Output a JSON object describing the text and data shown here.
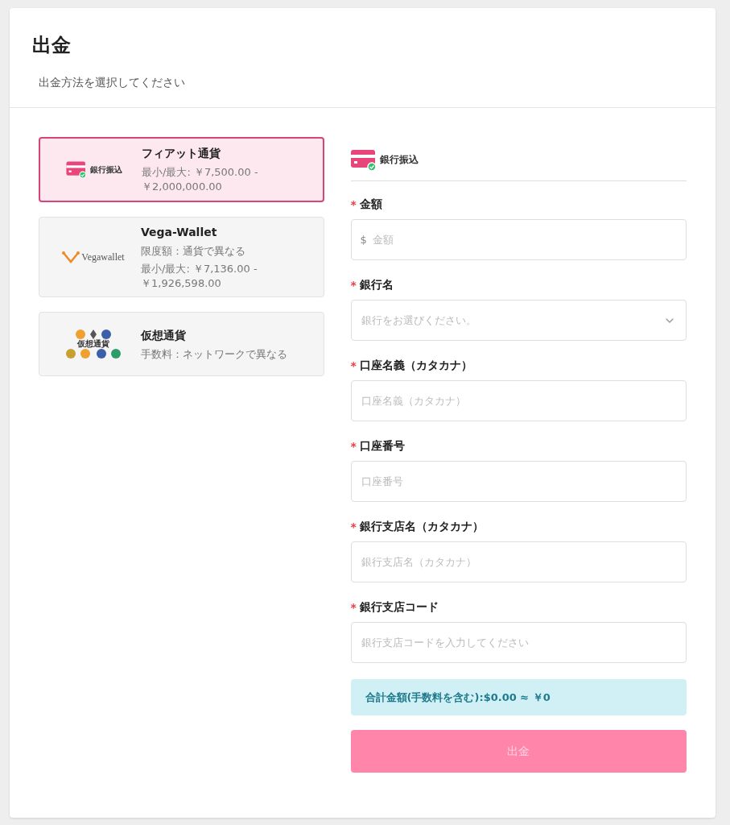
{
  "title": "出金",
  "subtitle": "出金方法を選択してください",
  "methods": [
    {
      "kind": "bank",
      "logo_text": "銀行振込",
      "name": "フィアット通貨",
      "lines": [
        "最小/最大: ￥7,500.00 - ￥2,000,000.00"
      ],
      "selected": true
    },
    {
      "kind": "wallet",
      "logo_text": "Vegawallet",
      "name": "Vega-Wallet",
      "lines": [
        "限度額：通貨で異なる",
        "最小/最大: ￥7,136.00 - ￥1,926,598.00"
      ],
      "selected": false
    },
    {
      "kind": "crypto",
      "logo_text": "仮想通貨",
      "name": "仮想通貨",
      "lines": [
        "手数料：ネットワークで異なる"
      ],
      "selected": false
    }
  ],
  "form_header": {
    "label": "銀行振込"
  },
  "fields": [
    {
      "kind": "input",
      "required_mark": "*",
      "label": "金額",
      "prefix": "$",
      "placeholder": "金額"
    },
    {
      "kind": "select",
      "required_mark": "*",
      "label": "銀行名",
      "placeholder": "銀行をお選びください。"
    },
    {
      "kind": "input",
      "required_mark": "*",
      "label": "口座名義（カタカナ）",
      "placeholder": "口座名義（カタカナ）"
    },
    {
      "kind": "input",
      "required_mark": "*",
      "label": "口座番号",
      "placeholder": "口座番号"
    },
    {
      "kind": "input",
      "required_mark": "*",
      "label": "銀行支店名（カタカナ）",
      "placeholder": "銀行支店名（カタカナ）"
    },
    {
      "kind": "input",
      "required_mark": "*",
      "label": "銀行支店コード",
      "placeholder": "銀行支店コードを入力してください"
    }
  ],
  "total": "合計金額(手数料を含む):$0.00 ≈ ￥0",
  "submit": {
    "label": "出金",
    "disabled": true
  }
}
